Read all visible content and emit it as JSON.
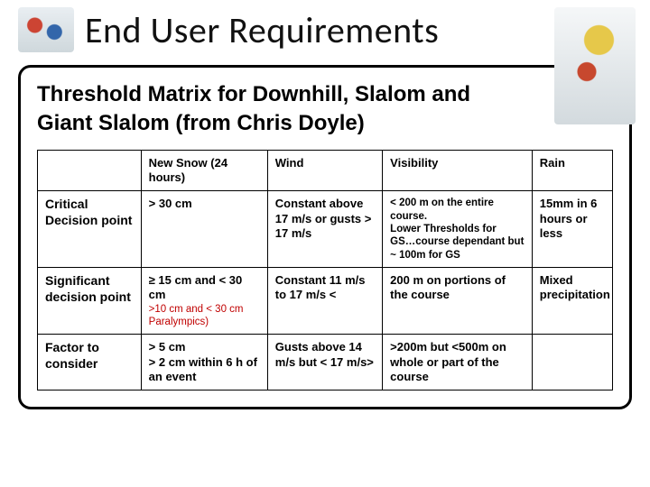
{
  "title": "End User Requirements",
  "subtitle": "Threshold Matrix for Downhill, Slalom and Giant Slalom (from Chris Doyle)",
  "header": {
    "blank": "",
    "snow": "New Snow (24 hours)",
    "wind": "Wind",
    "vis": "Visibility",
    "rain": "Rain"
  },
  "rows": {
    "critical": {
      "label": "Critical Decision point",
      "snow": "> 30 cm",
      "wind": "Constant above 17 m/s or gusts > 17 m/s",
      "vis_line1": "< 200 m on the entire course.",
      "vis_line2": "Lower Thresholds for GS…course dependant but ~ 100m for GS",
      "rain": "15mm in 6 hours or less"
    },
    "significant": {
      "label": "Significant decision point",
      "snow_line1": "≥ 15 cm and < 30 cm",
      "snow_line2": ">10 cm and < 30 cm Paralympics)",
      "wind": "Constant  11 m/s to 17 m/s <",
      "vis": "200 m on portions of the course",
      "rain": "Mixed precipitation"
    },
    "factor": {
      "label": "Factor to consider",
      "snow_line1": "> 5 cm",
      "snow_line2": "> 2 cm within 6 h of an event",
      "wind": "Gusts above 14 m/s but < 17 m/s>",
      "vis": ">200m but <500m on whole or part of the course",
      "rain": ""
    }
  }
}
